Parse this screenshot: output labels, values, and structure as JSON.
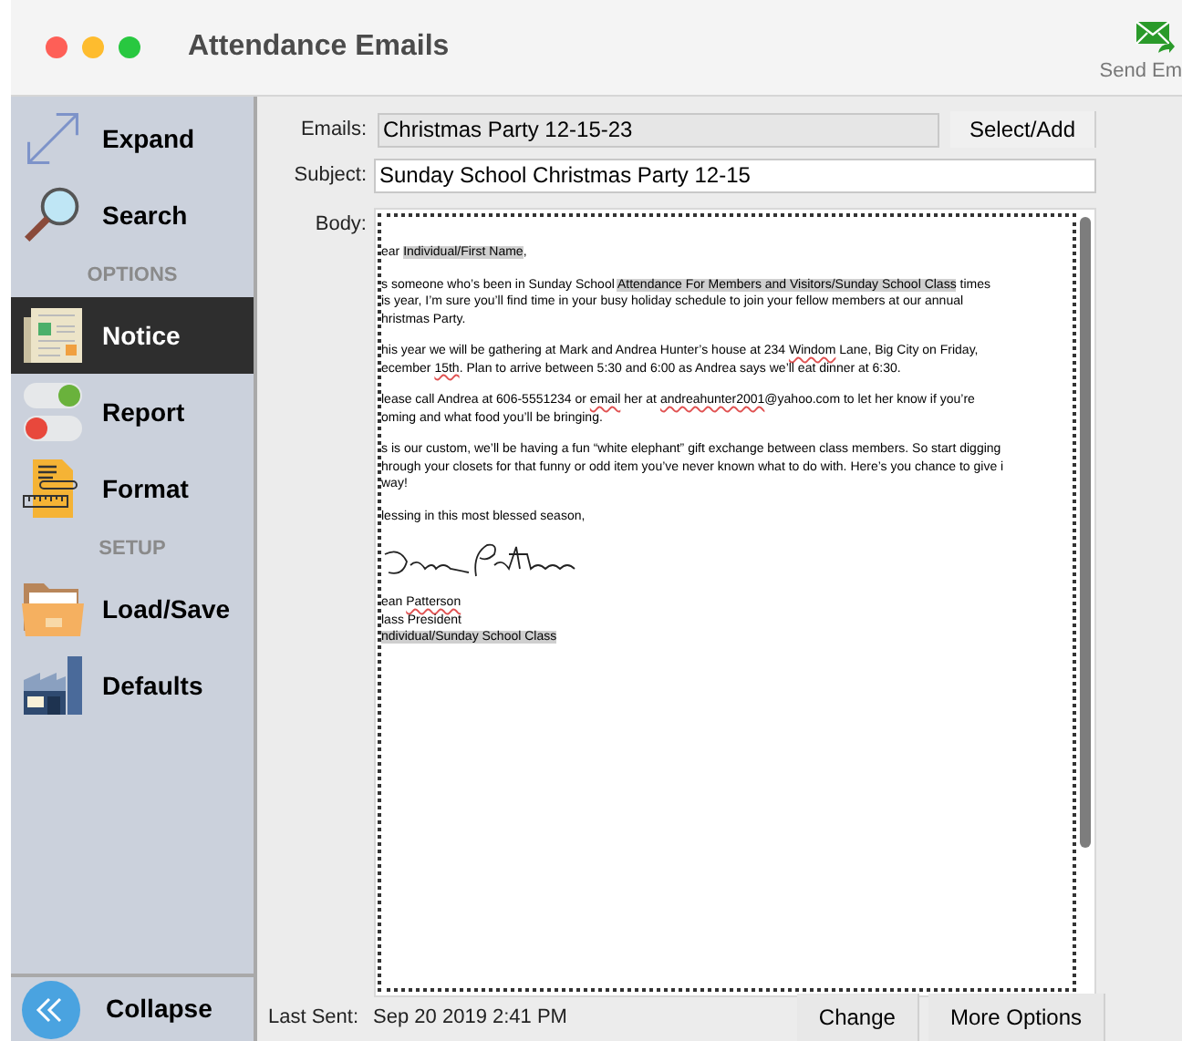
{
  "window": {
    "title": "Attendance Emails"
  },
  "toolbar": {
    "send_button": "Send Em"
  },
  "sidebar": {
    "items": [
      {
        "kind": "item",
        "label": "Expand",
        "selected": false
      },
      {
        "kind": "item",
        "label": "Search",
        "selected": false
      },
      {
        "kind": "header",
        "label": "OPTIONS"
      },
      {
        "kind": "item",
        "label": "Notice",
        "selected": true
      },
      {
        "kind": "item",
        "label": "Report",
        "selected": false
      },
      {
        "kind": "item",
        "label": "Format",
        "selected": false
      },
      {
        "kind": "header",
        "label": "SETUP"
      },
      {
        "kind": "item",
        "label": "Load/Save",
        "selected": false
      },
      {
        "kind": "item",
        "label": "Defaults",
        "selected": false
      }
    ],
    "collapse": "Collapse"
  },
  "form": {
    "emails_label": "Emails:",
    "emails_value": "Christmas Party 12-15-23",
    "select_button": "Select/Add",
    "subject_label": "Subject:",
    "subject_value": "Sunday School Christmas Party 12-15",
    "body_label": "Body:"
  },
  "body": [
    {
      "kind": "text",
      "lines": [
        [
          {
            "text": "ear "
          },
          {
            "text": "Individual/First Name",
            "highlighted": true
          },
          {
            "text": ","
          }
        ]
      ]
    },
    {
      "kind": "text",
      "lines": [
        [
          {
            "text": "s someone who’s been in Sunday School "
          },
          {
            "text": "Attendance For Members and Visitors/Sunday School Class",
            "highlighted": true
          },
          {
            "text": " times"
          }
        ],
        [
          {
            "text": "is year, I’m sure you’ll find time in your busy holiday schedule to join your fellow members at our annual"
          }
        ],
        [
          {
            "text": "hristmas Party."
          }
        ]
      ]
    },
    {
      "kind": "text",
      "lines": [
        [
          {
            "text": "his year we will be gathering at Mark and Andrea Hunter’s house at 234 "
          },
          {
            "text": "Windom",
            "misspelled": true
          },
          {
            "text": " Lane, Big City on Friday,"
          }
        ],
        [
          {
            "text": "ecember "
          },
          {
            "text": "15th",
            "misspelled": true
          },
          {
            "text": ". Plan to arrive between 5:30 and 6:00 as Andrea says we’ll eat dinner at 6:30."
          }
        ]
      ]
    },
    {
      "kind": "text",
      "lines": [
        [
          {
            "text": "lease call Andrea at 606-5551234 or "
          },
          {
            "text": "email",
            "misspelled": true
          },
          {
            "text": " her at "
          },
          {
            "text": "andreahunter2001",
            "misspelled": true
          },
          {
            "text": "@yahoo.com to let her know if you’re"
          }
        ],
        [
          {
            "text": "oming and what food you’ll be bringing."
          }
        ]
      ]
    },
    {
      "kind": "text",
      "lines": [
        [
          {
            "text": "s is our custom, we’ll be having a fun “white elephant” gift exchange between class members. So start digging"
          }
        ],
        [
          {
            "text": "hrough your closets for that funny or odd item you’ve never known what to do with. Here’s you chance to give i"
          }
        ],
        [
          {
            "text": "way!"
          }
        ]
      ]
    },
    {
      "kind": "text",
      "lines": [
        [
          {
            "text": "lessing in this most blessed season,"
          }
        ]
      ]
    },
    {
      "kind": "signature"
    },
    {
      "kind": "text",
      "lines": [
        [
          {
            "text": "ean "
          },
          {
            "text": "Patterson",
            "misspelled": true
          }
        ],
        [
          {
            "text": "lass President"
          }
        ],
        [
          {
            "text": "ndividual/Sunday School Class",
            "highlighted": true
          }
        ]
      ]
    }
  ],
  "footer": {
    "last_sent_label": "Last Sent:",
    "last_sent_value": "Sep 20 2019 2:41 PM",
    "buttons": [
      "Change",
      "More Options"
    ]
  }
}
